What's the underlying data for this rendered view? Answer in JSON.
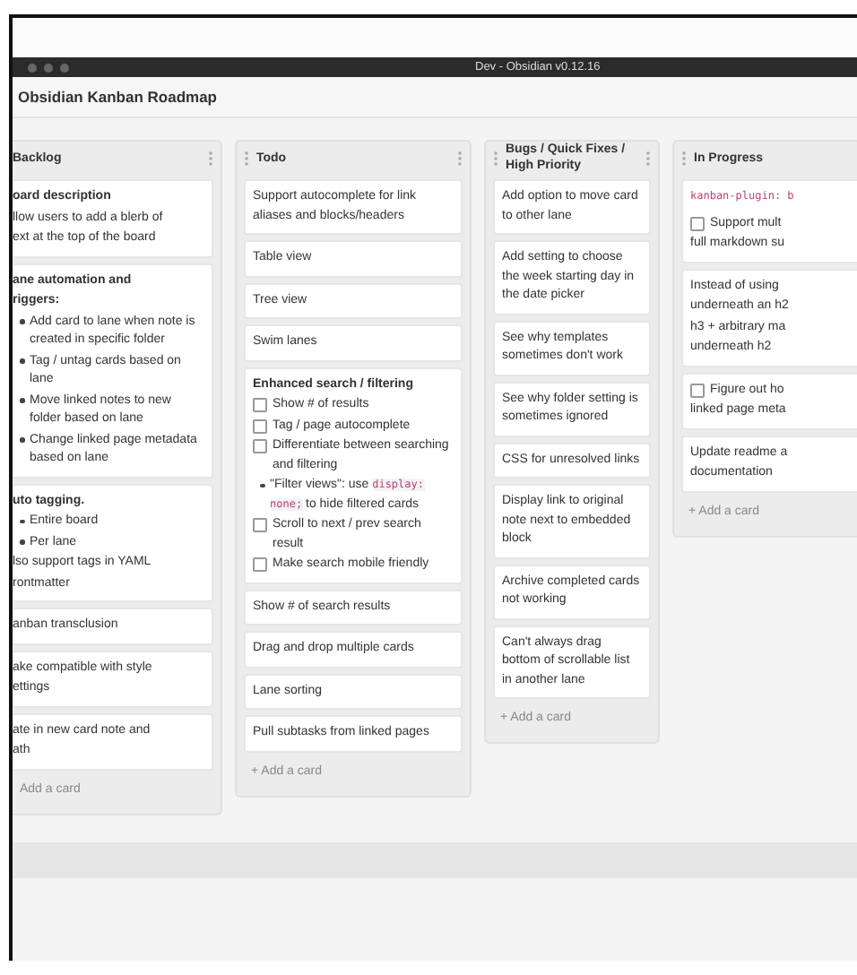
{
  "window": {
    "title": "Dev - Obsidian v0.12.16"
  },
  "board": {
    "title": "Obsidian Kanban Roadmap"
  },
  "lanes": [
    {
      "title": "Backlog",
      "cards": [
        {
          "blocks": [
            {
              "kind": "heading",
              "text": "oard description"
            },
            {
              "kind": "line",
              "text": "llow users to add a blerb of"
            },
            {
              "kind": "line",
              "text": "ext at the top of the board"
            }
          ]
        },
        {
          "blocks": [
            {
              "kind": "heading",
              "text": "ane automation and"
            },
            {
              "kind": "heading",
              "text": "riggers:"
            },
            {
              "kind": "bullet",
              "text": "Add card to lane when note is created in specific folder"
            },
            {
              "kind": "bullet",
              "text": "Tag / untag cards based on lane"
            },
            {
              "kind": "bullet",
              "text": "Move linked notes to new folder based on lane"
            },
            {
              "kind": "bullet",
              "text": "Change linked page metadata based on lane"
            }
          ]
        },
        {
          "blocks": [
            {
              "kind": "heading",
              "text": "uto tagging."
            },
            {
              "kind": "bullet",
              "text": "Entire board"
            },
            {
              "kind": "bullet",
              "text": "Per lane"
            },
            {
              "kind": "line",
              "text": "lso support tags in YAML"
            },
            {
              "kind": "line",
              "text": "rontmatter"
            }
          ]
        },
        {
          "blocks": [
            {
              "kind": "line",
              "text": "anban transclusion"
            }
          ]
        },
        {
          "blocks": [
            {
              "kind": "line",
              "text": "ake compatible with style"
            },
            {
              "kind": "line",
              "text": "ettings"
            }
          ]
        },
        {
          "blocks": [
            {
              "kind": "line",
              "text": "ate in new card note and"
            },
            {
              "kind": "line",
              "text": "ath"
            }
          ]
        }
      ],
      "add": "Add a card"
    },
    {
      "title": "Todo",
      "cards": [
        {
          "blocks": [
            {
              "kind": "text",
              "text": "Support autocomplete for link aliases and blocks/headers"
            }
          ]
        },
        {
          "blocks": [
            {
              "kind": "text",
              "text": "Table view"
            }
          ]
        },
        {
          "blocks": [
            {
              "kind": "text",
              "text": "Tree view"
            }
          ]
        },
        {
          "blocks": [
            {
              "kind": "text",
              "text": "Swim lanes"
            }
          ]
        },
        {
          "blocks": [
            {
              "kind": "heading",
              "text": "Enhanced search / filtering"
            },
            {
              "kind": "task",
              "text": "Show # of results",
              "checked": false
            },
            {
              "kind": "task",
              "text": "Tag / page autocomplete",
              "checked": false
            },
            {
              "kind": "task",
              "text": "Differentiate between searching and filtering",
              "checked": false
            },
            {
              "kind": "bullet",
              "text": "\"Filter views\": use",
              "code": "display: none;",
              "after": "to hide filtered cards"
            },
            {
              "kind": "task",
              "text": "Scroll to next / prev search result",
              "checked": false
            },
            {
              "kind": "task",
              "text": "Make search mobile friendly",
              "checked": false
            }
          ]
        },
        {
          "blocks": [
            {
              "kind": "text",
              "text": "Show # of search results"
            }
          ]
        },
        {
          "blocks": [
            {
              "kind": "text",
              "text": "Drag and drop multiple cards"
            }
          ]
        },
        {
          "blocks": [
            {
              "kind": "text",
              "text": "Lane sorting"
            }
          ]
        },
        {
          "blocks": [
            {
              "kind": "text",
              "text": "Pull subtasks from linked pages"
            }
          ]
        }
      ],
      "add": "+ Add a card"
    },
    {
      "title": "Bugs / Quick Fixes / High Priority",
      "cards": [
        {
          "blocks": [
            {
              "kind": "text",
              "text": "Add option to move card to other lane"
            }
          ]
        },
        {
          "blocks": [
            {
              "kind": "text",
              "text": "Add setting to choose the week starting day in the date picker"
            }
          ]
        },
        {
          "blocks": [
            {
              "kind": "text",
              "text": "See why templates sometimes don't work"
            }
          ]
        },
        {
          "blocks": [
            {
              "kind": "text",
              "text": "See why folder setting is sometimes ignored"
            }
          ]
        },
        {
          "blocks": [
            {
              "kind": "text",
              "text": "CSS for unresolved links"
            }
          ]
        },
        {
          "blocks": [
            {
              "kind": "text",
              "text": "Display link to original note next to embedded block"
            }
          ]
        },
        {
          "blocks": [
            {
              "kind": "text",
              "text": "Archive completed cards not working"
            }
          ]
        },
        {
          "blocks": [
            {
              "kind": "text",
              "text": "Can't always drag bottom of scrollable list in another lane"
            }
          ]
        }
      ],
      "add": "+ Add a card"
    },
    {
      "title": "In Progress",
      "cards": [
        {
          "blocks": [
            {
              "kind": "codeline",
              "text": "kanban-plugin: b"
            },
            {
              "kind": "task",
              "text": "Support mult",
              "checked": false
            },
            {
              "kind": "line",
              "text": "full markdown su"
            }
          ]
        },
        {
          "blocks": [
            {
              "kind": "line",
              "text": "Instead of using"
            },
            {
              "kind": "line",
              "text": "underneath an h2"
            },
            {
              "kind": "line",
              "text": "h3 + arbitrary ma"
            },
            {
              "kind": "line",
              "text": "underneath h2"
            }
          ]
        },
        {
          "blocks": [
            {
              "kind": "task",
              "text": "Figure out ho",
              "checked": false
            },
            {
              "kind": "line",
              "text": "linked page meta"
            }
          ]
        },
        {
          "blocks": [
            {
              "kind": "line",
              "text": "Update readme a"
            },
            {
              "kind": "line",
              "text": "documentation"
            }
          ]
        }
      ],
      "add": "+ Add a card"
    }
  ]
}
